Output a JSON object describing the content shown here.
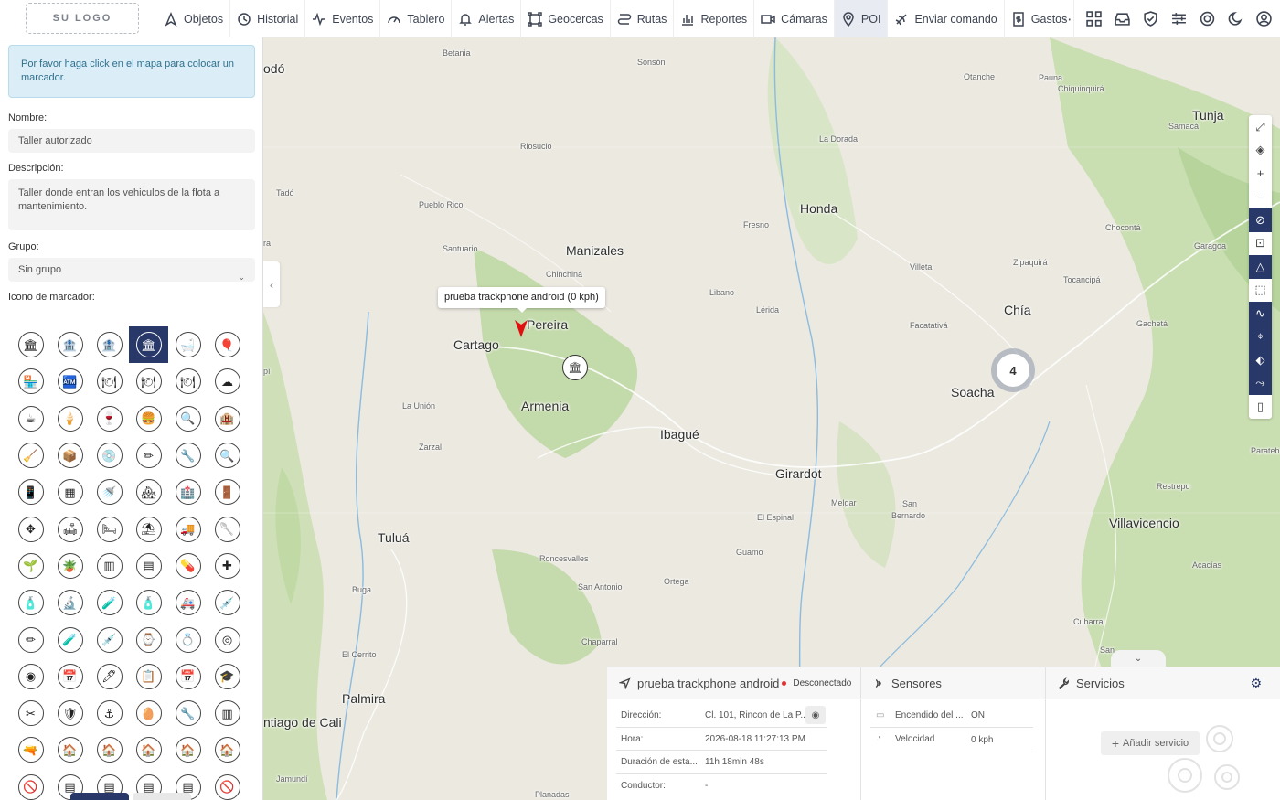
{
  "brand": {
    "logo_text": "SU LOGO",
    "accent": "#283868"
  },
  "nav": [
    {
      "key": "objetos",
      "label": "Objetos",
      "icon": "navigation-arrow-icon"
    },
    {
      "key": "historial",
      "label": "Historial",
      "icon": "history-icon"
    },
    {
      "key": "eventos",
      "label": "Eventos",
      "icon": "activity-icon"
    },
    {
      "key": "tablero",
      "label": "Tablero",
      "icon": "gauge-icon"
    },
    {
      "key": "alertas",
      "label": "Alertas",
      "icon": "bell-icon"
    },
    {
      "key": "geocercas",
      "label": "Geocercas",
      "icon": "geofence-icon"
    },
    {
      "key": "rutas",
      "label": "Rutas",
      "icon": "route-icon"
    },
    {
      "key": "reportes",
      "label": "Reportes",
      "icon": "bar-chart-icon"
    },
    {
      "key": "camaras",
      "label": "Cámaras",
      "icon": "video-camera-icon"
    },
    {
      "key": "poi",
      "label": "POI",
      "icon": "map-pin-icon",
      "active": true
    },
    {
      "key": "enviar",
      "label": "Enviar comando",
      "icon": "send-command-icon"
    },
    {
      "key": "gastos",
      "label": "Gastos",
      "icon": "receipt-icon"
    }
  ],
  "header_icons": [
    "more-icon",
    "apps-grid-icon",
    "inbox-icon",
    "shield-icon",
    "sliders-icon",
    "support-icon",
    "dark-mode-icon",
    "user-icon"
  ],
  "panel": {
    "alert": "Por favor haga click en el mapa para colocar un marcador.",
    "name_label": "Nombre:",
    "name_value": "Taller autorizado",
    "desc_label": "Descripción:",
    "desc_value": "Taller donde entran los vehiculos de la flota a mantenimiento.",
    "group_label": "Grupo:",
    "group_value": "Sin grupo",
    "icon_label": "Icono de marcador:",
    "selected_icon": 3,
    "icons": [
      "🏛",
      "🏦",
      "🏦",
      "🏛",
      "🛁",
      "🎈",
      "🏪",
      "🏧",
      "🍽",
      "🍽",
      "🍽",
      "☁",
      "☕",
      "🍦",
      "🍷",
      "🍔",
      "🔍",
      "🏨",
      "🧹",
      "📦",
      "💿",
      "✏",
      "🔧",
      "🔍",
      "📱",
      "▦",
      "🚿",
      "🏘",
      "🏥",
      "🚪",
      "✥",
      "🛋",
      "🛏",
      "⛱",
      "🚚",
      "🥄",
      "🌱",
      "🪴",
      "▥",
      "▤",
      "💊",
      "✚",
      "🧴",
      "🔬",
      "🧪",
      "🧴",
      "🚑",
      "💉",
      "✏",
      "🧪",
      "💉",
      "⌚",
      "💍",
      "◎",
      "◉",
      "📅",
      "🖊",
      "📋",
      "📅",
      "🎓",
      "✂",
      "🛡",
      "⚓",
      "🥚",
      "🔧",
      "▥",
      "🔫",
      "🏠",
      "🏠",
      "🏠",
      "🏠",
      "🏠",
      "🚫",
      "▤",
      "▤",
      "▤",
      "▤",
      "🚫"
    ]
  },
  "map": {
    "tooltip": "prueba trackphone android (0 kph)",
    "cluster_count": "4",
    "places": [
      {
        "name": "Betania",
        "size": "s"
      },
      {
        "name": "Sonsón",
        "size": "s"
      },
      {
        "name": "Otanche",
        "size": "s"
      },
      {
        "name": "Pauna",
        "size": "s"
      },
      {
        "name": "Chiquinquirá",
        "size": "s"
      },
      {
        "name": "Tunja",
        "size": "l"
      },
      {
        "name": "Samacá",
        "size": "s"
      },
      {
        "name": "Riosucio",
        "size": "s"
      },
      {
        "name": "La Dorada",
        "size": "s"
      },
      {
        "name": "Tadó",
        "size": "s"
      },
      {
        "name": "Pueblo Rico",
        "size": "s"
      },
      {
        "name": "Honda",
        "size": "l"
      },
      {
        "name": "Fresno",
        "size": "s"
      },
      {
        "name": "Chocontá",
        "size": "s"
      },
      {
        "name": "Santuario",
        "size": "s"
      },
      {
        "name": "Manizales",
        "size": "l"
      },
      {
        "name": "Garagoa",
        "size": "s"
      },
      {
        "name": "Chinchiná",
        "size": "s"
      },
      {
        "name": "Villeta",
        "size": "s"
      },
      {
        "name": "Zipaquirá",
        "size": "s"
      },
      {
        "name": "Tocancipá",
        "size": "s"
      },
      {
        "name": "Libano",
        "size": "s"
      },
      {
        "name": "Lérida",
        "size": "s"
      },
      {
        "name": "Chía",
        "size": "l"
      },
      {
        "name": "Pereira",
        "size": "l"
      },
      {
        "name": "Facatativá",
        "size": "s"
      },
      {
        "name": "Gachetá",
        "size": "s"
      },
      {
        "name": "Cartago",
        "size": "l"
      },
      {
        "name": "Soacha",
        "size": "l"
      },
      {
        "name": "Armenia",
        "size": "l"
      },
      {
        "name": "La Unión",
        "size": "s"
      },
      {
        "name": "Ibagué",
        "size": "l"
      },
      {
        "name": "Zarzal",
        "size": "s"
      },
      {
        "name": "Paratebue",
        "size": "s"
      },
      {
        "name": "Girardot",
        "size": "l"
      },
      {
        "name": "Restrepo",
        "size": "s"
      },
      {
        "name": "Melgar",
        "size": "s"
      },
      {
        "name": "San",
        "size": "s"
      },
      {
        "name": "Bernardo",
        "size": "s"
      },
      {
        "name": "El Espinal",
        "size": "s"
      },
      {
        "name": "Villavicencio",
        "size": "l"
      },
      {
        "name": "Tuluá",
        "size": "l"
      },
      {
        "name": "Roncesvalles",
        "size": "s"
      },
      {
        "name": "Guamo",
        "size": "s"
      },
      {
        "name": "Acacías",
        "size": "s"
      },
      {
        "name": "San Antonio",
        "size": "s"
      },
      {
        "name": "Ortega",
        "size": "s"
      },
      {
        "name": "Buga",
        "size": "s"
      },
      {
        "name": "Chaparral",
        "size": "s"
      },
      {
        "name": "Cubarral",
        "size": "s"
      },
      {
        "name": "El Cerrito",
        "size": "s"
      },
      {
        "name": "Palmira",
        "size": "l"
      },
      {
        "name": "ntiago de Cali",
        "size": "l"
      },
      {
        "name": "Jamundí",
        "size": "s"
      },
      {
        "name": "Planadas",
        "size": "s"
      },
      {
        "name": "odó",
        "size": "l"
      },
      {
        "name": "ra",
        "size": "s"
      },
      {
        "name": "pí",
        "size": "s"
      },
      {
        "name": "San",
        "size": "s"
      }
    ],
    "tools": [
      {
        "icon": "fullscreen-icon"
      },
      {
        "icon": "layers-icon"
      },
      {
        "icon": "zoom-in-icon"
      },
      {
        "icon": "zoom-out-icon"
      },
      {
        "icon": "overlap-icon",
        "dark": true
      },
      {
        "icon": "fit-bounds-icon"
      },
      {
        "icon": "objects-layer-icon",
        "dark": true
      },
      {
        "icon": "geofence-layer-icon"
      },
      {
        "icon": "routes-layer-icon",
        "dark": true
      },
      {
        "icon": "poi-layer-icon",
        "dark": true
      },
      {
        "icon": "tag-icon",
        "dark": true
      },
      {
        "icon": "measure-icon",
        "dark": true
      },
      {
        "icon": "ruler-icon"
      }
    ]
  },
  "dock": {
    "device": {
      "title": "prueba trackphone android",
      "status": "Desconectado",
      "status_color": "#e03030",
      "rows": [
        {
          "label": "Dirección:",
          "value": "Cl. 101, Rincon de La P..."
        },
        {
          "label": "Hora:",
          "value": "2026-08-18 11:27:13 PM"
        },
        {
          "label": "Duración de esta...",
          "value": "11h 18min 48s"
        },
        {
          "label": "Conductor:",
          "value": "-"
        }
      ]
    },
    "sensors": {
      "title": "Sensores",
      "rows": [
        {
          "label": "Encendido del ...",
          "value": "ON"
        },
        {
          "label": "Velocidad",
          "value": "0 kph"
        }
      ]
    },
    "services": {
      "title": "Servicios",
      "add_label": "Añadir servicio"
    }
  }
}
